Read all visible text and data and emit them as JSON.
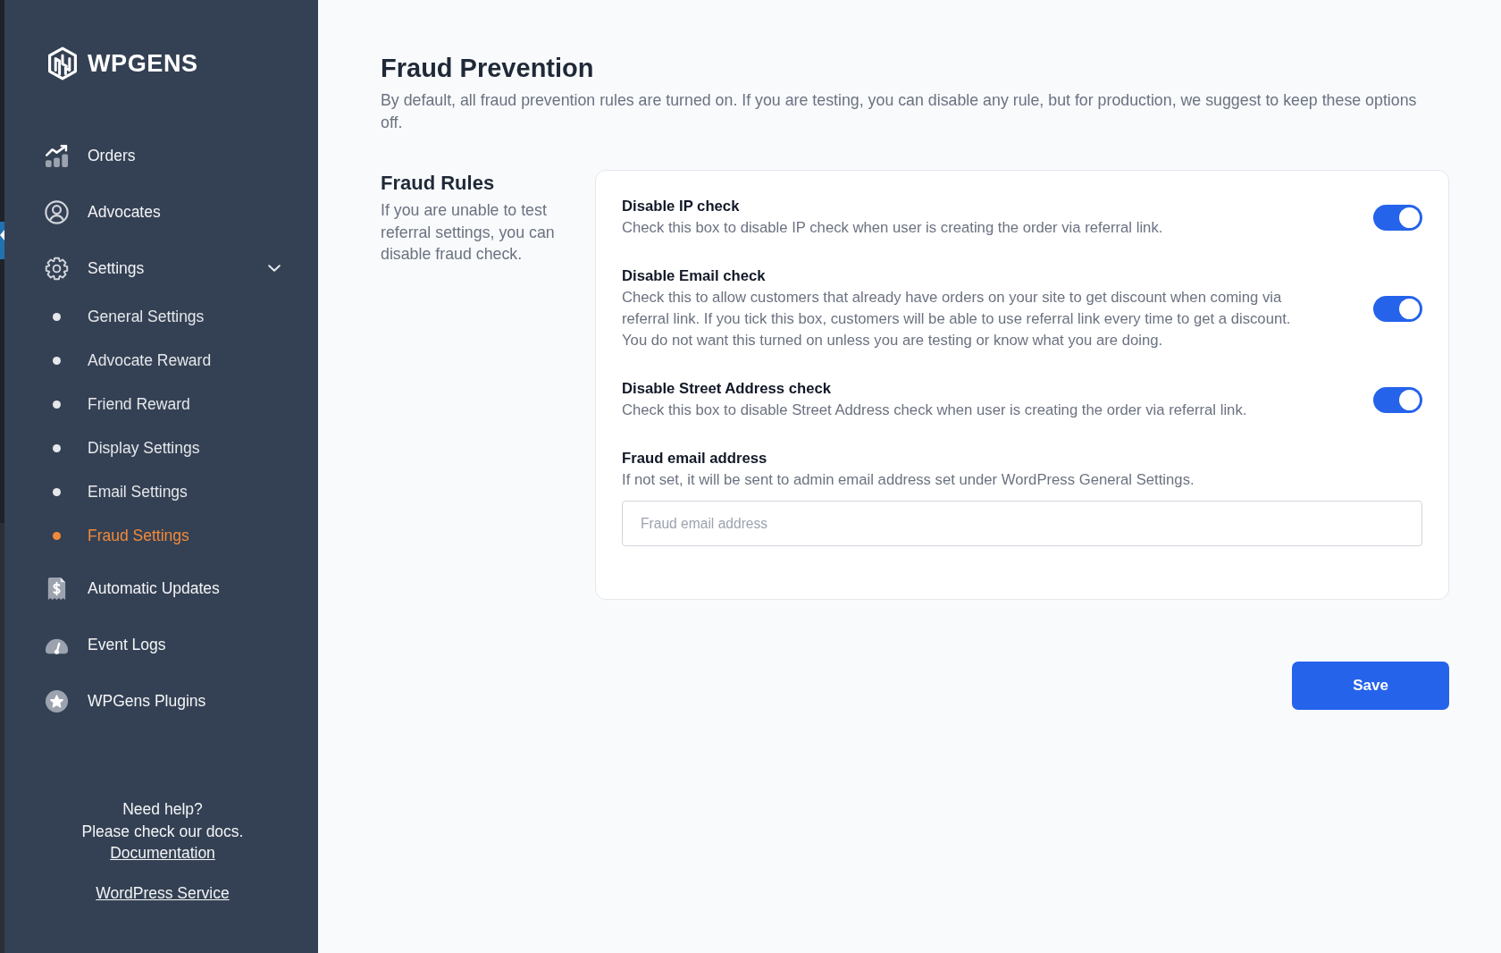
{
  "sidebar": {
    "logo": {
      "text": "WPGENS"
    },
    "nav": [
      {
        "kind": "link",
        "label": "Orders",
        "selected": false
      },
      {
        "kind": "link",
        "label": "Advocates",
        "selected": false
      },
      {
        "kind": "group",
        "label": "Settings",
        "selected": false,
        "expanded": true,
        "children": [
          {
            "label": "General Settings",
            "selected": false
          },
          {
            "label": "Advocate Reward",
            "selected": false
          },
          {
            "label": "Friend Reward",
            "selected": false
          },
          {
            "label": "Display Settings",
            "selected": false
          },
          {
            "label": "Email Settings",
            "selected": false
          },
          {
            "label": "Fraud Settings",
            "selected": true
          }
        ]
      },
      {
        "kind": "link",
        "label": "Automatic Updates",
        "selected": false
      },
      {
        "kind": "link",
        "label": "Event Logs",
        "selected": false
      },
      {
        "kind": "link",
        "label": "WPGens Plugins",
        "selected": false
      }
    ],
    "help": {
      "title": "Need help?",
      "text": "Please check our docs.",
      "links": [
        "Documentation",
        "WordPress Service"
      ]
    }
  },
  "page": {
    "title": "Fraud Prevention",
    "description": "By default, all fraud prevention rules are turned on. If you are testing, you can disable any rule, but for production, we suggest to keep these options off."
  },
  "section": {
    "title": "Fraud Rules",
    "description": "If you are unable to test referral settings, you can disable fraud check."
  },
  "rules": [
    {
      "label": "Disable IP check",
      "description": "Check this box to disable IP check when user is creating the order via referral link.",
      "on": true
    },
    {
      "label": "Disable Email check",
      "description": "Check this to allow customers that already have orders on your site to get discount when coming via referral link. If you tick this box, customers will be able to use referral link every time to get a discount. You do not want this turned on unless you are testing or know what you are doing.",
      "on": true
    },
    {
      "label": "Disable Street Address check",
      "description": "Check this box to disable Street Address check when user is creating the order via referral link.",
      "on": true
    }
  ],
  "email_field": {
    "label": "Fraud email address",
    "description": "If not set, it will be sent to admin email address set under WordPress General Settings.",
    "placeholder": "Fraud email address"
  },
  "save_button": {
    "label": "Save"
  }
}
